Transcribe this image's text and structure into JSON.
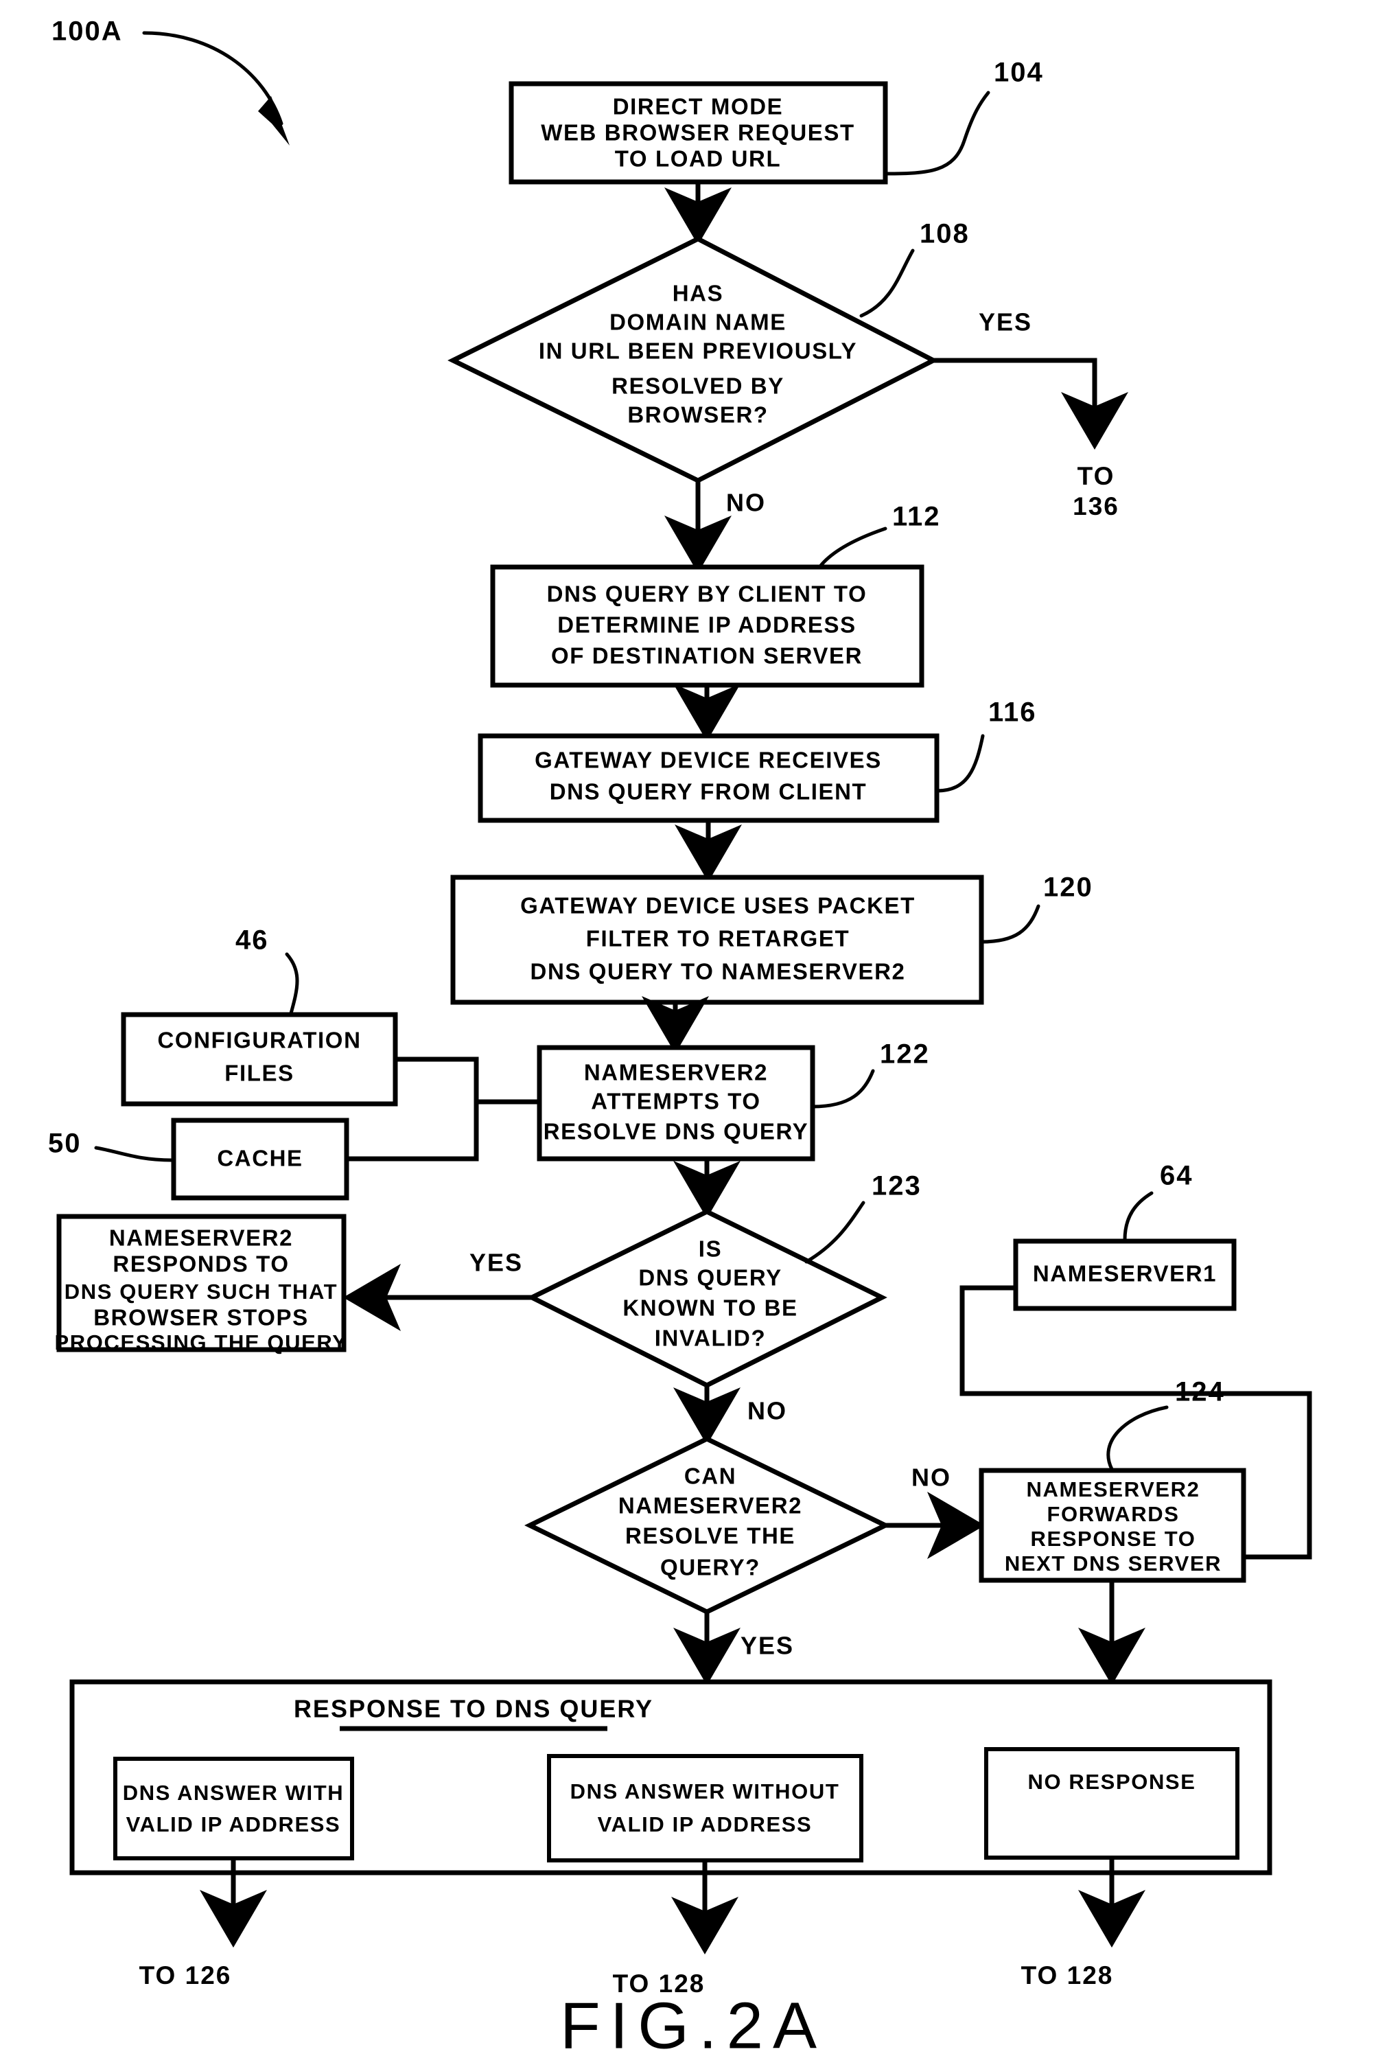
{
  "figure": {
    "caption": "FIG.2A",
    "flow_label": "100A"
  },
  "nodes": {
    "n104": {
      "ref": "104",
      "type": "process",
      "lines": [
        "DIRECT MODE",
        "WEB BROWSER REQUEST",
        "TO LOAD URL"
      ]
    },
    "n108": {
      "ref": "108",
      "type": "decision",
      "lines": [
        "HAS",
        "DOMAIN NAME",
        "IN URL BEEN PREVIOUSLY",
        "RESOLVED BY",
        "BROWSER?"
      ],
      "yes_label": "YES",
      "no_label": "NO",
      "yes_target": [
        "TO",
        "136"
      ]
    },
    "n112": {
      "ref": "112",
      "type": "process",
      "lines": [
        "DNS QUERY BY CLIENT TO",
        "DETERMINE IP ADDRESS",
        "OF DESTINATION SERVER"
      ]
    },
    "n116": {
      "ref": "116",
      "type": "process",
      "lines": [
        "GATEWAY DEVICE RECEIVES",
        "DNS QUERY FROM CLIENT"
      ]
    },
    "n120": {
      "ref": "120",
      "type": "process",
      "lines": [
        "GATEWAY DEVICE USES PACKET",
        "FILTER TO RETARGET",
        "DNS QUERY TO NAMESERVER2"
      ]
    },
    "n46": {
      "ref": "46",
      "type": "datastore",
      "lines": [
        "CONFIGURATION",
        "FILES"
      ]
    },
    "n50": {
      "ref": "50",
      "type": "datastore",
      "lines": [
        "CACHE"
      ]
    },
    "n122": {
      "ref": "122",
      "type": "process",
      "lines": [
        "NAMESERVER2",
        "ATTEMPTS TO",
        "RESOLVE DNS QUERY"
      ]
    },
    "n123": {
      "ref": "123",
      "type": "decision",
      "lines": [
        "IS",
        "DNS QUERY",
        "KNOWN TO BE",
        "INVALID?"
      ],
      "yes_label": "YES",
      "no_label": "NO"
    },
    "n_responds": {
      "ref": "",
      "type": "process",
      "lines": [
        "NAMESERVER2",
        "RESPONDS TO",
        "DNS QUERY SUCH THAT",
        "BROWSER STOPS",
        "PROCESSING THE QUERY"
      ]
    },
    "n64": {
      "ref": "64",
      "type": "process",
      "lines": [
        "NAMESERVER1"
      ]
    },
    "n_canresolve": {
      "ref": "",
      "type": "decision",
      "lines": [
        "CAN",
        "NAMESERVER2",
        "RESOLVE THE",
        "QUERY?"
      ],
      "yes_label": "YES",
      "no_label": "NO"
    },
    "n124": {
      "ref": "124",
      "type": "process",
      "lines": [
        "NAMESERVER2",
        "FORWARDS",
        "RESPONSE TO",
        "NEXT DNS SERVER"
      ]
    },
    "n_response_group": {
      "ref": "",
      "type": "group",
      "title": "RESPONSE TO DNS QUERY",
      "children": [
        {
          "lines": [
            "DNS ANSWER WITH",
            "VALID IP ADDRESS"
          ],
          "exit": [
            "TO",
            "126"
          ]
        },
        {
          "lines": [
            "DNS ANSWER WITHOUT",
            "VALID IP ADDRESS"
          ],
          "exit": [
            "TO",
            "128"
          ]
        },
        {
          "lines": [
            "NO RESPONSE"
          ],
          "exit": [
            "TO",
            "128"
          ]
        }
      ]
    }
  },
  "exit_labels": {
    "e1": "TO 126",
    "e2": "TO 128",
    "e3": "TO 128"
  },
  "colors": {
    "stroke": "#000000",
    "fill": "#ffffff",
    "background": "#ffffff"
  }
}
